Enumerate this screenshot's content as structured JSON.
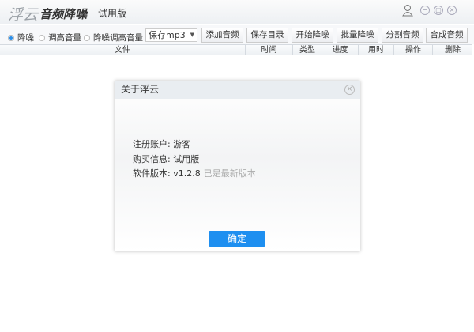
{
  "titlebar": {
    "logo": "浮云",
    "app_name": "音频降噪",
    "edition": "试用版",
    "icons": [
      "user-icon",
      "minimize-icon",
      "restore-icon",
      "close-icon"
    ]
  },
  "toolbar": {
    "modes": [
      {
        "label": "降噪",
        "selected": true
      },
      {
        "label": "调高音量",
        "selected": false
      },
      {
        "label": "降噪调高音量",
        "selected": false
      }
    ],
    "format_select": "保存mp3",
    "buttons": [
      "添加音频",
      "保存目录",
      "开始降噪",
      "批量降噪",
      "分割音频",
      "合成音频"
    ]
  },
  "table": {
    "columns": [
      "文件",
      "时间",
      "类型",
      "进度",
      "用时",
      "操作",
      "删除"
    ]
  },
  "dialog": {
    "title": "关于浮云",
    "account_label": "注册账户:",
    "account_value": "游客",
    "purchase_label": "购买信息:",
    "purchase_value": "试用版",
    "version_label": "软件版本:",
    "version_value": "v1.2.8",
    "version_status": "已是最新版本",
    "ok_label": "确定",
    "accent": "#1e8ff0"
  }
}
